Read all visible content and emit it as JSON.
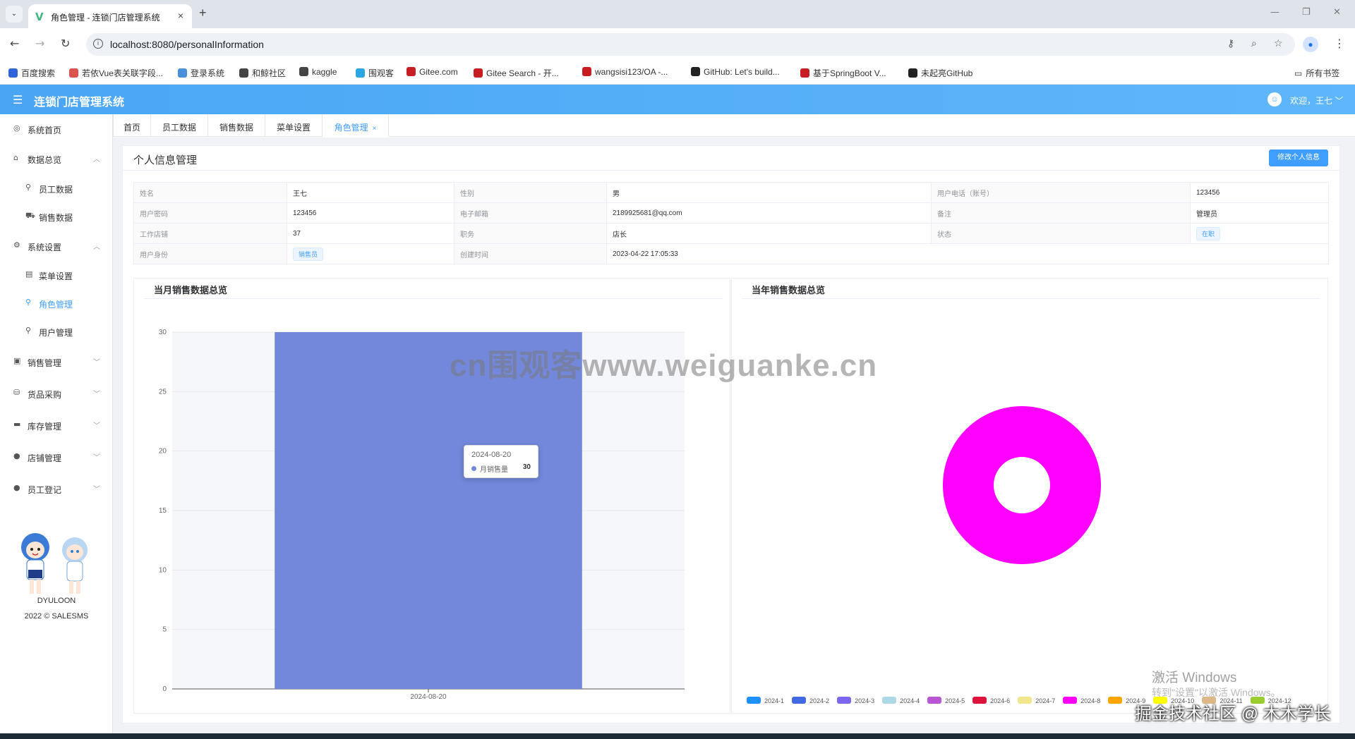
{
  "browser": {
    "tab_title": "角色管理 - 连锁门店管理系统",
    "tab_close": "×",
    "new_tab": "+",
    "url": "localhost:8080/personalInformation",
    "bookmarks": [
      {
        "label": "百度搜索",
        "color": "#2f63d8"
      },
      {
        "label": "若依Vue表关联字段...",
        "color": "#d9534f"
      },
      {
        "label": "登录系统",
        "color": "#4a90d9"
      },
      {
        "label": "和鲸社区",
        "color": "#444444"
      },
      {
        "label": "kaggle",
        "color": "#444444"
      },
      {
        "label": "围观客",
        "color": "#2aa7e0"
      },
      {
        "label": "Gitee.com",
        "color": "#c71d23"
      },
      {
        "label": "Gitee Search - 开...",
        "color": "#c71d23"
      },
      {
        "label": "wangsisi123/OA -...",
        "color": "#c71d23"
      },
      {
        "label": "GitHub: Let's build...",
        "color": "#222222"
      },
      {
        "label": "基于SpringBoot V...",
        "color": "#c71d23"
      },
      {
        "label": "未起亮GitHub",
        "color": "#222222"
      }
    ],
    "all_bookmarks": "所有书签"
  },
  "app": {
    "title": "连锁门店管理系统",
    "welcome": "欢迎，王七"
  },
  "sidebar": {
    "items": [
      {
        "label": "系统首页",
        "icon": "◎",
        "arrow": "",
        "sub": false,
        "active": false
      },
      {
        "label": "数据总览",
        "icon": "⌂",
        "arrow": "︿",
        "sub": false,
        "active": false
      },
      {
        "label": "员工数据",
        "icon": "⚲",
        "arrow": "",
        "sub": true,
        "active": false
      },
      {
        "label": "销售数据",
        "icon": "⛟",
        "arrow": "",
        "sub": true,
        "active": false
      },
      {
        "label": "系统设置",
        "icon": "⚙",
        "arrow": "︿",
        "sub": false,
        "active": false
      },
      {
        "label": "菜单设置",
        "icon": "▤",
        "arrow": "",
        "sub": true,
        "active": false
      },
      {
        "label": "角色管理",
        "icon": "⚲",
        "arrow": "",
        "sub": true,
        "active": true
      },
      {
        "label": "用户管理",
        "icon": "⚲",
        "arrow": "",
        "sub": true,
        "active": false
      },
      {
        "label": "销售管理",
        "icon": "▣",
        "arrow": "﹀",
        "sub": false,
        "active": false
      },
      {
        "label": "货品采购",
        "icon": "⛁",
        "arrow": "﹀",
        "sub": false,
        "active": false
      },
      {
        "label": "库存管理",
        "icon": "▬",
        "arrow": "﹀",
        "sub": false,
        "active": false
      },
      {
        "label": "店铺管理",
        "icon": "●",
        "arrow": "﹀",
        "sub": false,
        "active": false
      },
      {
        "label": "员工登记",
        "icon": "●",
        "arrow": "﹀",
        "sub": false,
        "active": false
      }
    ],
    "brand": "DYULOON",
    "copyright": "2022 © SALESMS"
  },
  "tabs": [
    {
      "label": "首页",
      "active": false
    },
    {
      "label": "员工数据",
      "active": false
    },
    {
      "label": "销售数据",
      "active": false
    },
    {
      "label": "菜单设置",
      "active": false
    },
    {
      "label": "角色管理",
      "active": true,
      "close": "×"
    }
  ],
  "profile": {
    "title": "个人信息管理",
    "edit_button": "修改个人信息",
    "rows": [
      [
        {
          "label": "姓名",
          "value": "王七"
        },
        {
          "label": "性别",
          "value": "男"
        },
        {
          "label": "用户电话（账号）",
          "value": "123456"
        }
      ],
      [
        {
          "label": "用户密码",
          "value": "123456"
        },
        {
          "label": "电子邮箱",
          "value": "2189925681@qq.com"
        },
        {
          "label": "备注",
          "value": "管理员"
        }
      ],
      [
        {
          "label": "工作店铺",
          "value": "37"
        },
        {
          "label": "职务",
          "value": "店长"
        },
        {
          "label": "状态",
          "value": "在职",
          "tag": true
        }
      ],
      [
        {
          "label": "用户身份",
          "value": "销售员",
          "tag": true
        },
        {
          "label": "创建时间",
          "value": "2023-04-22 17:05:33",
          "span": true
        }
      ]
    ]
  },
  "monthly": {
    "title": "当月销售数据总览",
    "tooltip": {
      "date": "2024-08-20",
      "series": "月销售量",
      "value": "30"
    }
  },
  "yearly": {
    "title": "当年销售数据总览"
  },
  "chart_data": [
    {
      "type": "bar",
      "title": "当月销售数据总览",
      "categories": [
        "2024-08-20"
      ],
      "series": [
        {
          "name": "月销售量",
          "values": [
            30
          ],
          "color": "#7388db"
        }
      ],
      "yticks": [
        0,
        5,
        10,
        15,
        20,
        25,
        30
      ],
      "ylim": [
        0,
        30
      ],
      "grid": true
    },
    {
      "type": "pie",
      "title": "当年销售数据总览",
      "donut": true,
      "legend_position": "bottom",
      "slices": [
        {
          "label": "2024-1",
          "value": 0,
          "color": "#1e90ff"
        },
        {
          "label": "2024-2",
          "value": 0,
          "color": "#4169e1"
        },
        {
          "label": "2024-3",
          "value": 0,
          "color": "#7b68ee"
        },
        {
          "label": "2024-4",
          "value": 0,
          "color": "#add8e6"
        },
        {
          "label": "2024-5",
          "value": 0,
          "color": "#ba55d3"
        },
        {
          "label": "2024-6",
          "value": 0,
          "color": "#dc143c"
        },
        {
          "label": "2024-7",
          "value": 0,
          "color": "#f0e68c"
        },
        {
          "label": "2024-8",
          "value": 30,
          "color": "#ff00ff"
        },
        {
          "label": "2024-9",
          "value": 0,
          "color": "#ffa500"
        },
        {
          "label": "2024-10",
          "value": 0,
          "color": "#ffff00"
        },
        {
          "label": "2024-11",
          "value": 0,
          "color": "#deb887"
        },
        {
          "label": "2024-12",
          "value": 0,
          "color": "#9acd32"
        }
      ]
    }
  ],
  "overlays": {
    "watermark": "cn围观客www.weiguanke.cn",
    "activate_title": "激活 Windows",
    "activate_sub": "转到\"设置\"以激活 Windows。",
    "juejin": "掘金技术社区 @ 木木学长"
  }
}
